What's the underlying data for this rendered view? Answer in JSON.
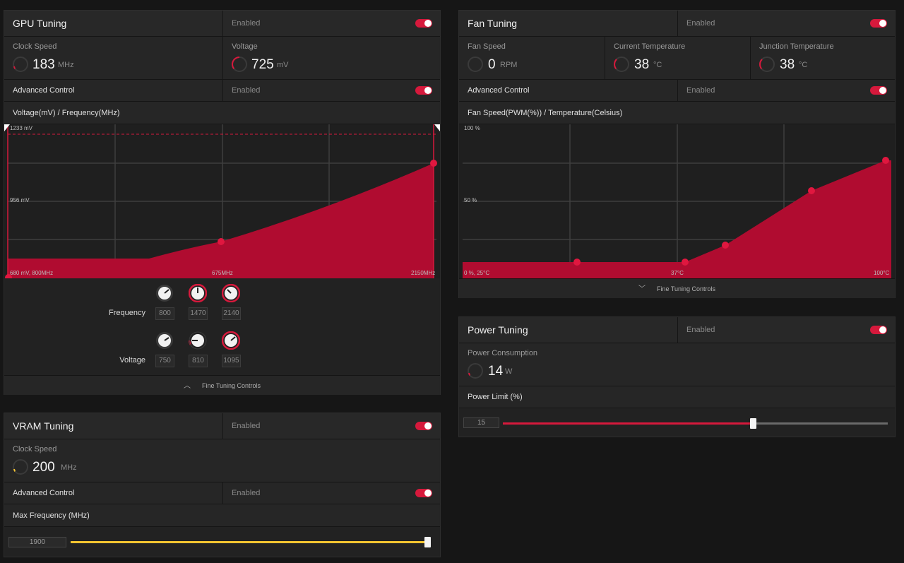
{
  "enabled_text": "Enabled",
  "gpu": {
    "title": "GPU Tuning",
    "clock_label": "Clock Speed",
    "clock_value": "183",
    "clock_unit": "MHz",
    "voltage_label": "Voltage",
    "voltage_value": "725",
    "voltage_unit": "mV",
    "advanced_label": "Advanced Control",
    "chart_title": "Voltage(mV) / Frequency(MHz)",
    "chart_labels": {
      "top": "1233 mV",
      "mid": "956 mV",
      "bottom_left": "680 mV, 800MHz",
      "bottom_mid": "675MHz",
      "bottom_right": "2150MHz"
    },
    "frequency_label": "Frequency",
    "voltage_row_label": "Voltage",
    "frequency_knobs": [
      "800",
      "1470",
      "2140"
    ],
    "voltage_knobs": [
      "750",
      "810",
      "1095"
    ],
    "fine_tuning": "Fine Tuning Controls"
  },
  "vram": {
    "title": "VRAM Tuning",
    "clock_label": "Clock Speed",
    "clock_value": "200",
    "clock_unit": "MHz",
    "advanced_label": "Advanced Control",
    "max_freq_label": "Max Frequency (MHz)",
    "max_freq_value": "1900",
    "max_freq_fraction": 1.0
  },
  "fan": {
    "title": "Fan Tuning",
    "speed_label": "Fan Speed",
    "speed_value": "0",
    "speed_unit": "RPM",
    "cur_temp_label": "Current Temperature",
    "cur_temp_value": "38",
    "cur_temp_unit": "°C",
    "junc_temp_label": "Junction Temperature",
    "junc_temp_value": "38",
    "junc_temp_unit": "°C",
    "advanced_label": "Advanced Control",
    "chart_title": "Fan Speed(PWM(%)) / Temperature(Celsius)",
    "chart_labels": {
      "top": "100 %",
      "mid": "50 %",
      "bottom_left": "0 %, 25°C",
      "bottom_mid": "37°C",
      "bottom_right": "100°C"
    },
    "fine_tuning": "Fine Tuning Controls"
  },
  "power": {
    "title": "Power Tuning",
    "consumption_label": "Power Consumption",
    "consumption_value": "14",
    "consumption_unit": "W",
    "limit_label": "Power Limit (%)",
    "limit_value": "15",
    "limit_fraction": 0.65
  },
  "colors": {
    "accent": "#d6193c",
    "vram_accent": "#f5c531",
    "curve_fill": "#b00c30"
  }
}
